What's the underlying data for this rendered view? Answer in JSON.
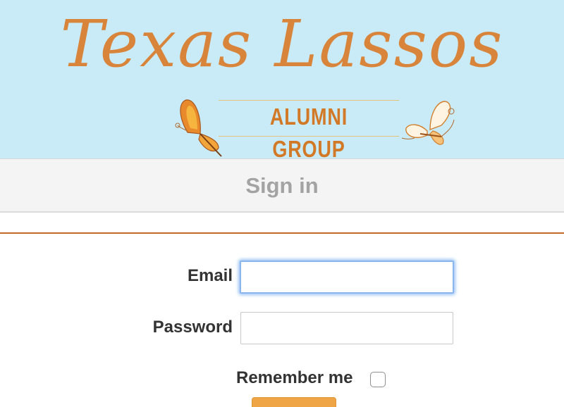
{
  "header": {
    "logo_title": "Texas Lassos",
    "logo_subtitle": "ALUMNI GROUP",
    "colors": {
      "banner_background": "#c9ebf8",
      "logo_orange": "#d8843a",
      "accent_line": "#e7c07c"
    },
    "icons": [
      "butterfly-icon",
      "butterfly-icon"
    ]
  },
  "signin_bar": {
    "title": "Sign in"
  },
  "form": {
    "email": {
      "label": "Email",
      "value": "",
      "placeholder": ""
    },
    "password": {
      "label": "Password",
      "value": "",
      "placeholder": ""
    },
    "remember": {
      "label": "Remember me",
      "checked": false
    },
    "submit": {
      "color": "#efa545"
    }
  },
  "colors": {
    "divider": "#c46a26",
    "focus_ring": "#8ab6ee"
  }
}
